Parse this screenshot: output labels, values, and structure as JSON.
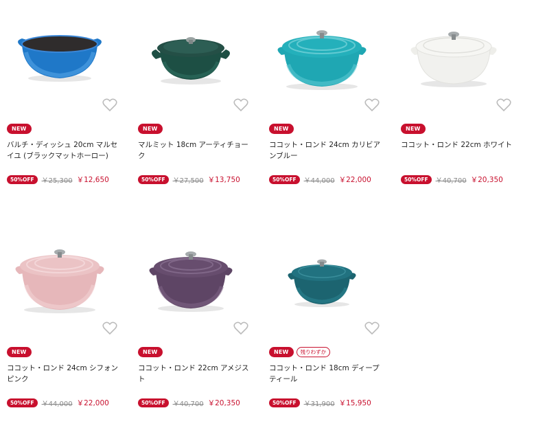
{
  "products": [
    {
      "name": "バルチ・ディッシュ 20cm マルセイユ (ブラックマットホーロー)",
      "badge": "NEW",
      "discount": "50%OFF",
      "original_price": "￥25,300",
      "sale_price": "￥12,650",
      "color": "#1f78c8"
    },
    {
      "name": "マルミット 18cm アーティチョーク",
      "badge": "NEW",
      "discount": "50%OFF",
      "original_price": "￥27,500",
      "sale_price": "￥13,750",
      "color": "#1d4f44"
    },
    {
      "name": "ココット・ロンド 24cm カリビアンブルー",
      "badge": "NEW",
      "discount": "50%OFF",
      "original_price": "￥44,000",
      "sale_price": "￥22,000",
      "color": "#1fa7b3"
    },
    {
      "name": "ココット・ロンド 22cm ホワイト",
      "badge": "NEW",
      "discount": "50%OFF",
      "original_price": "￥40,700",
      "sale_price": "￥20,350",
      "color": "#f1f1ee"
    },
    {
      "name": "ココット・ロンド 24cm シフォンピンク",
      "badge": "NEW",
      "discount": "50%OFF",
      "original_price": "￥44,000",
      "sale_price": "￥22,000",
      "color": "#e6b7ba"
    },
    {
      "name": "ココット・ロンド 22cm アメジスト",
      "badge": "NEW",
      "discount": "50%OFF",
      "original_price": "￥40,700",
      "sale_price": "￥20,350",
      "color": "#5e4565"
    },
    {
      "name": "ココット・ロンド 18cm ディープティール",
      "badge": "NEW",
      "stock_badge": "残りわずか",
      "discount": "50%OFF",
      "original_price": "￥31,900",
      "sale_price": "￥15,950",
      "color": "#1c6470"
    }
  ],
  "colors": {
    "accent": "#c8102e",
    "text": "#222222",
    "muted": "#888888"
  }
}
